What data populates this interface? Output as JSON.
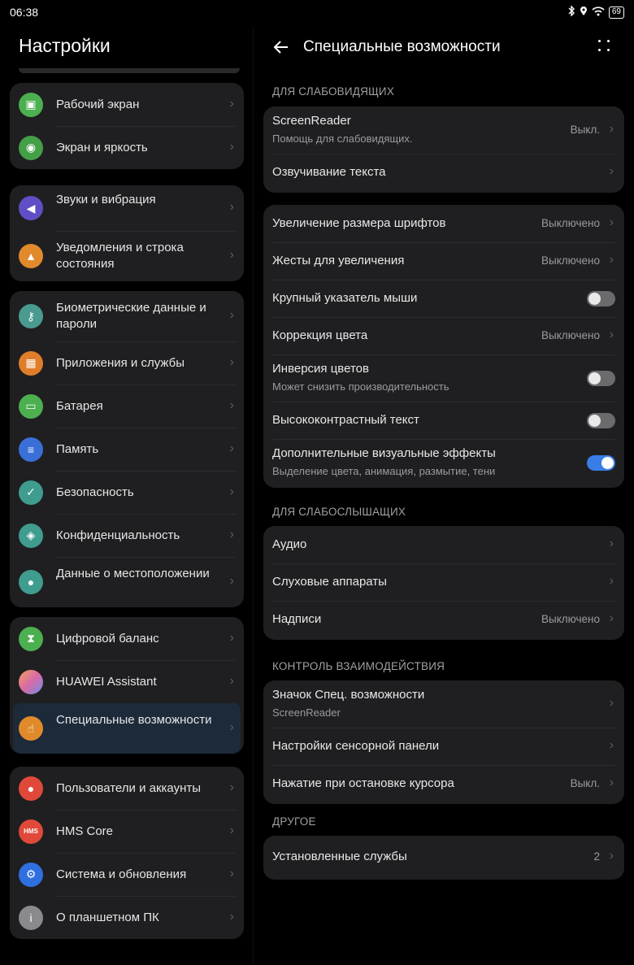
{
  "status": {
    "time": "06:38",
    "battery": "69"
  },
  "left": {
    "title": "Настройки",
    "groups": [
      [
        {
          "label": "Рабочий экран",
          "icon": "image-icon"
        },
        {
          "label": "Экран и яркость",
          "icon": "eye-icon"
        }
      ],
      [
        {
          "label": "Звуки и вибрация",
          "icon": "speaker-icon"
        },
        {
          "label": "Уведомления и строка состояния",
          "icon": "bell-icon"
        }
      ],
      [
        {
          "label": "Биометрические данные и пароли",
          "icon": "key-icon"
        },
        {
          "label": "Приложения и службы",
          "icon": "apps-icon"
        },
        {
          "label": "Батарея",
          "icon": "battery-icon"
        },
        {
          "label": "Память",
          "icon": "storage-icon"
        },
        {
          "label": "Безопасность",
          "icon": "shield-icon"
        },
        {
          "label": "Конфиденциальность",
          "icon": "privacy-icon"
        },
        {
          "label": "Данные о местоположении",
          "icon": "location-icon"
        }
      ],
      [
        {
          "label": "Цифровой баланс",
          "icon": "hourglass-icon"
        },
        {
          "label": "HUAWEI Assistant",
          "icon": "assistant-icon"
        },
        {
          "label": "Специальные возможности",
          "icon": "accessibility-icon"
        }
      ],
      [
        {
          "label": "Пользователи и аккаунты",
          "icon": "user-icon"
        },
        {
          "label": "HMS Core",
          "icon": "hms-icon",
          "icon_text": "HMS"
        },
        {
          "label": "Система и обновления",
          "icon": "gear-icon"
        },
        {
          "label": "О планшетном ПК",
          "icon": "info-icon"
        }
      ]
    ]
  },
  "right": {
    "title": "Специальные возможности",
    "sections": [
      {
        "header": "ДЛЯ СЛАБОВИДЯЩИХ",
        "rows": [
          {
            "title": "ScreenReader",
            "subtitle": "Помощь для слабовидящих.",
            "value": "Выкл."
          },
          {
            "title": "Озвучивание текста"
          }
        ]
      },
      {
        "header": "",
        "rows": [
          {
            "title": "Увеличение размера шрифтов",
            "value": "Выключено"
          },
          {
            "title": "Жесты для увеличения",
            "value": "Выключено"
          },
          {
            "title": "Крупный указатель мыши",
            "toggle": false
          },
          {
            "title": "Коррекция цвета",
            "value": "Выключено"
          },
          {
            "title": "Инверсия цветов",
            "subtitle": "Может снизить производительность",
            "toggle": false
          },
          {
            "title": "Высококонтрастный текст",
            "toggle": false
          },
          {
            "title": "Дополнительные визуальные эффекты",
            "subtitle": "Выделение цвета, анимация, размытие, тени",
            "toggle": true
          }
        ]
      },
      {
        "header": "ДЛЯ СЛАБОСЛЫШАЩИХ",
        "rows": [
          {
            "title": "Аудио"
          },
          {
            "title": "Слуховые аппараты"
          },
          {
            "title": "Надписи",
            "value": "Выключено"
          }
        ]
      },
      {
        "header": "КОНТРОЛЬ ВЗАИМОДЕЙСТВИЯ",
        "rows": [
          {
            "title": "Значок Спец. возможности",
            "subtitle": "ScreenReader"
          },
          {
            "title": "Настройки сенсорной панели"
          },
          {
            "title": "Нажатие при остановке курсора",
            "value": "Выкл."
          }
        ]
      },
      {
        "header": "ДРУГОЕ",
        "rows": [
          {
            "title": "Установленные службы",
            "value": "2"
          }
        ]
      }
    ]
  },
  "colors": {
    "accent": "#3b7de8",
    "card": "#1f1f21",
    "background": "#000000"
  }
}
